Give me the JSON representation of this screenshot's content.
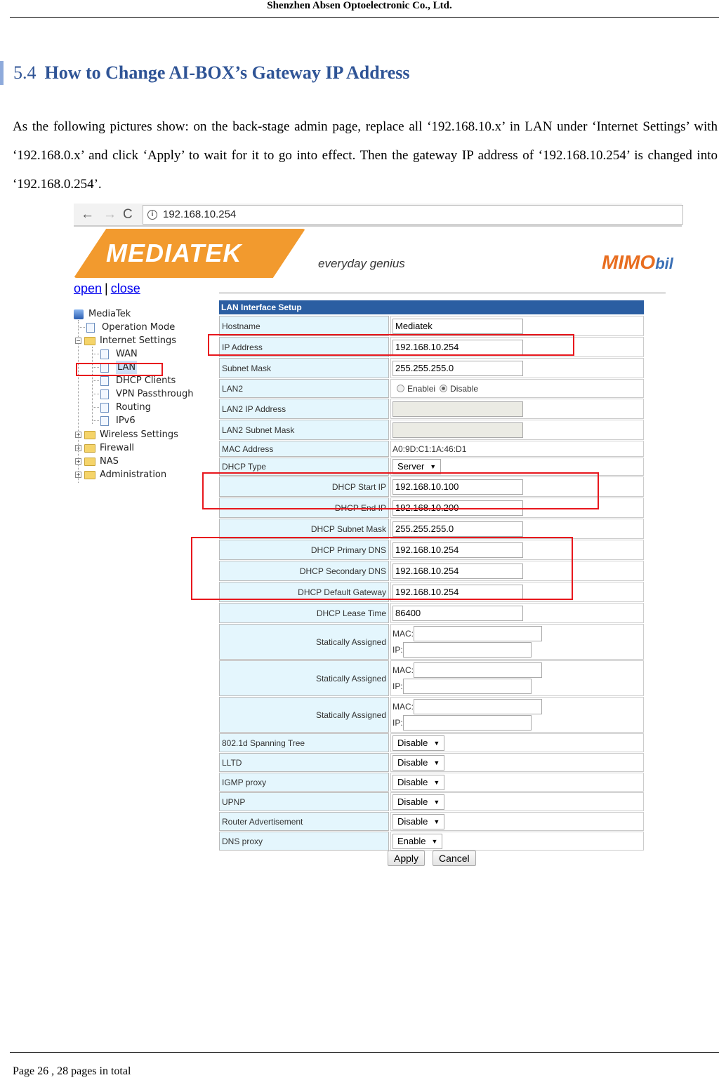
{
  "page_header": "Shenzhen Absen Optoelectronic Co., Ltd.",
  "section": {
    "number": "5.4",
    "title": "How to Change AI-BOX’s Gateway IP Address"
  },
  "body_text": "As the following pictures show: on the back-stage admin page, replace all ‘192.168.10.x’ in LAN under ‘Internet Settings’ with ‘192.168.0.x’ and click ‘Apply’ to wait for it to go into effect. Then the gateway IP address of ‘192.168.10.254’ is changed into ‘192.168.0.254’.",
  "browser": {
    "back_icon": "←",
    "forward_icon": "→",
    "reload_icon": "C",
    "info_icon": "i",
    "url": "192.168.10.254"
  },
  "banner": {
    "logo": "MEDIATEK",
    "tagline": "everyday genius",
    "partner_logo_main": "MIMO",
    "partner_logo_tail": "bil"
  },
  "tree_controls": {
    "open": "open",
    "separator": "|",
    "close": "close"
  },
  "tree": {
    "root": "MediaTek",
    "items": [
      {
        "label": "Operation Mode",
        "type": "page",
        "level": 1
      },
      {
        "label": "Internet Settings",
        "type": "folder-open",
        "level": 1
      },
      {
        "label": "WAN",
        "type": "page",
        "level": 2
      },
      {
        "label": "LAN",
        "type": "page",
        "level": 2,
        "selected": true
      },
      {
        "label": "DHCP Clients",
        "type": "page",
        "level": 2
      },
      {
        "label": "VPN Passthrough",
        "type": "page",
        "level": 2
      },
      {
        "label": "Routing",
        "type": "page",
        "level": 2
      },
      {
        "label": "IPv6",
        "type": "page",
        "level": 2
      },
      {
        "label": "Wireless Settings",
        "type": "folder",
        "level": 1
      },
      {
        "label": "Firewall",
        "type": "folder",
        "level": 1
      },
      {
        "label": "NAS",
        "type": "folder",
        "level": 1
      },
      {
        "label": "Administration",
        "type": "folder",
        "level": 1
      }
    ]
  },
  "form": {
    "title": "LAN Interface Setup",
    "hostname": {
      "label": "Hostname",
      "value": "Mediatek"
    },
    "ip_address": {
      "label": "IP Address",
      "value": "192.168.10.254"
    },
    "subnet_mask": {
      "label": "Subnet Mask",
      "value": "255.255.255.0"
    },
    "lan2": {
      "label": "LAN2",
      "option_enable": "Enablei",
      "option_disable": "Disable",
      "selected": "Disable"
    },
    "lan2_ip": {
      "label": "LAN2 IP Address",
      "value": ""
    },
    "lan2_subnet": {
      "label": "LAN2 Subnet Mask",
      "value": ""
    },
    "mac_address": {
      "label": "MAC Address",
      "value": "A0:9D:C1:1A:46:D1"
    },
    "dhcp_type": {
      "label": "DHCP Type",
      "value": "Server"
    },
    "dhcp_start": {
      "label": "DHCP Start IP",
      "value": "192.168.10.100"
    },
    "dhcp_end": {
      "label": "DHCP End IP",
      "value": "192.168.10.200"
    },
    "dhcp_subnet": {
      "label": "DHCP Subnet Mask",
      "value": "255.255.255.0"
    },
    "dhcp_dns1": {
      "label": "DHCP Primary DNS",
      "value": "192.168.10.254"
    },
    "dhcp_dns2": {
      "label": "DHCP Secondary DNS",
      "value": "192.168.10.254"
    },
    "dhcp_gateway": {
      "label": "DHCP Default Gateway",
      "value": "192.168.10.254"
    },
    "dhcp_lease": {
      "label": "DHCP Lease Time",
      "value": "86400"
    },
    "static": [
      {
        "label": "Statically Assigned",
        "mac_label": "MAC:",
        "ip_label": "IP:"
      },
      {
        "label": "Statically Assigned",
        "mac_label": "MAC:",
        "ip_label": "IP:"
      },
      {
        "label": "Statically Assigned",
        "mac_label": "MAC:",
        "ip_label": "IP:"
      }
    ],
    "spanning_tree": {
      "label": "802.1d Spanning Tree",
      "value": "Disable"
    },
    "lltd": {
      "label": "LLTD",
      "value": "Disable"
    },
    "igmp": {
      "label": "IGMP proxy",
      "value": "Disable"
    },
    "upnp": {
      "label": "UPNP",
      "value": "Disable"
    },
    "router_adv": {
      "label": "Router Advertisement",
      "value": "Disable"
    },
    "dns_proxy": {
      "label": "DNS proxy",
      "value": "Enable"
    },
    "apply_label": "Apply",
    "cancel_label": "Cancel"
  },
  "colors": {
    "heading": "#2f5496",
    "form_header": "#2b5ea2",
    "label_bg": "#e4f6fd",
    "highlight_box": "#e8171d",
    "mediatek_orange": "#f29a2e"
  },
  "footer": "Page 26 , 28 pages in total"
}
